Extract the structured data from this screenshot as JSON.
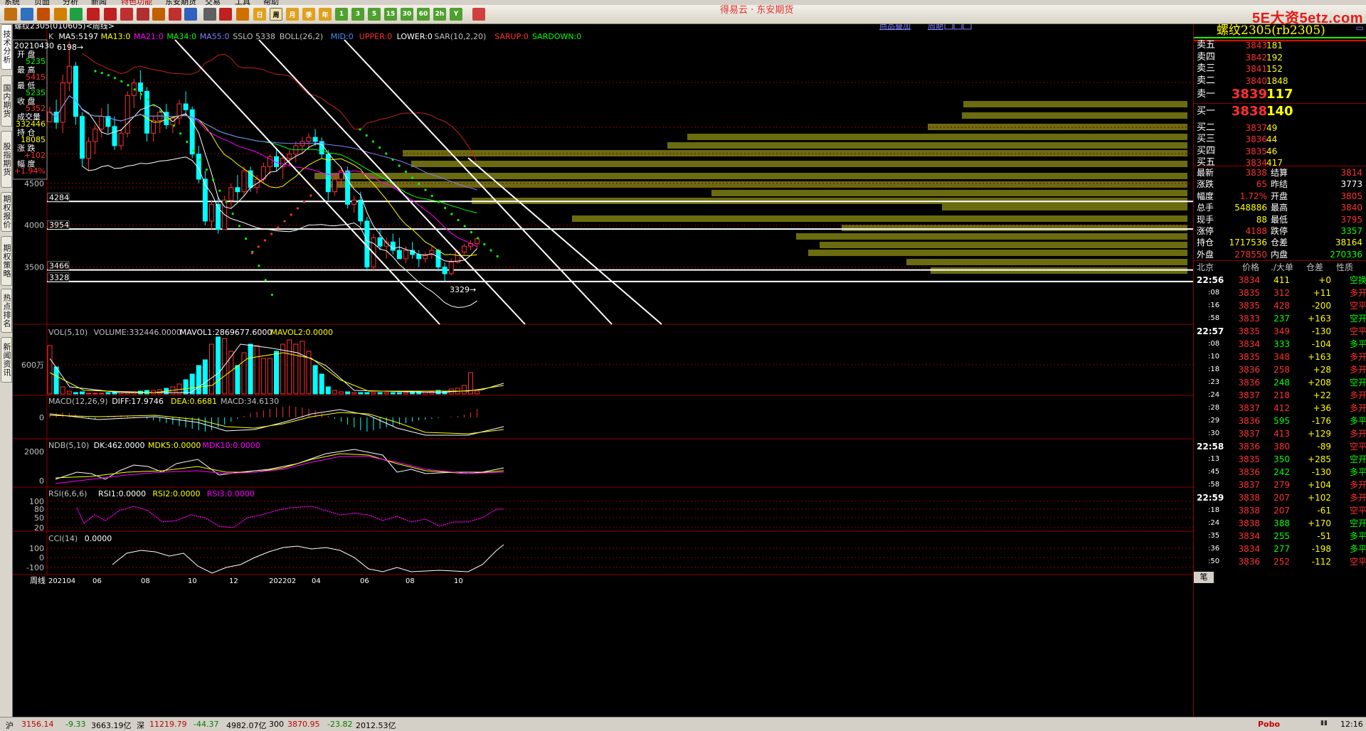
{
  "menu": [
    "系统",
    "页面",
    "分析",
    "新闻",
    "特色功能",
    "东安期货",
    "交易",
    "工具",
    "帮助"
  ],
  "banner": "得易云 · 东安期货",
  "watermark": "5E大资5etz.com",
  "toolbar_periods": [
    "日",
    "周",
    "月",
    "季",
    "年",
    "1",
    "3",
    "5",
    "15",
    "30",
    "60",
    "2h",
    "Y"
  ],
  "left_tabs": [
    "技术分析",
    "国内期货",
    "股指期货",
    "期权报价",
    "期权策略",
    "热点排名",
    "新闻资讯"
  ],
  "chart": {
    "title": "螺纹2305(010605)<周线>",
    "links": [
      "商品叠加",
      "周期"
    ],
    "ma_legend": [
      {
        "t": "K",
        "c": "#c0c0c0"
      },
      {
        "t": "MA5:5197",
        "c": "#ffffff"
      },
      {
        "t": "MA13:0",
        "c": "#ffff00"
      },
      {
        "t": "MA21:0",
        "c": "#ff00ff"
      },
      {
        "t": "MA34:0",
        "c": "#00ff00"
      },
      {
        "t": "MA55:0",
        "c": "#8080ff"
      },
      {
        "t": "SSLO 5338",
        "c": "#c0c0c0"
      },
      {
        "t": "BOLL(26,2)",
        "c": "#c0c0c0"
      },
      {
        "t": "MID:0",
        "c": "#4090ff"
      },
      {
        "t": "UPPER:0",
        "c": "#ff3030"
      },
      {
        "t": "LOWER:0",
        "c": "#ffffff"
      },
      {
        "t": "SAR(10,2,20)",
        "c": "#c0c0c0"
      },
      {
        "t": "SARUP:0",
        "c": "#ff3030"
      },
      {
        "t": "SARDOWN:0",
        "c": "#00ff00"
      }
    ],
    "price_ticks": [
      {
        "v": 4500,
        "l": "4500"
      },
      {
        "v": 4000,
        "l": "4000"
      },
      {
        "v": 3500,
        "l": "3500"
      }
    ],
    "hlines": [
      {
        "v": 4284,
        "l": "4284"
      },
      {
        "v": 3954,
        "l": "3954"
      },
      {
        "v": 3466,
        "l": "3466"
      },
      {
        "v": 3328,
        "l": "3328"
      }
    ],
    "peak_label": "6198",
    "low_label": "3329",
    "infobox": {
      "date": "20210430",
      "rows": [
        {
          "k": "开  盘",
          "v": "5235",
          "c": "#00ff00"
        },
        {
          "k": "最  高",
          "v": "5415",
          "c": "#ff3030"
        },
        {
          "k": "最  低",
          "v": "5235",
          "c": "#00ff00"
        },
        {
          "k": "收  盘",
          "v": "5352",
          "c": "#ff3030"
        },
        {
          "k": "成交量",
          "v": "332446",
          "c": "#ffff00"
        },
        {
          "k": "持  仓",
          "v": "18085",
          "c": "#ffff00"
        },
        {
          "k": "涨  跌",
          "v": "+102",
          "c": "#ff3030"
        },
        {
          "k": "幅  度",
          "v": "+1.94%",
          "c": "#ff3030"
        }
      ]
    },
    "vol_legend": [
      {
        "t": "VOL(5,10)",
        "c": "#c0c0c0"
      },
      {
        "t": "VOLUME:332446.0000",
        "c": "#c0c0c0"
      },
      {
        "t": "MAVOL1:2869677.6000",
        "c": "#ffffff"
      },
      {
        "t": "MAVOL2:0.0000",
        "c": "#ffff00"
      }
    ],
    "vol_tick": "600万",
    "macd_legend": [
      {
        "t": "MACD(12,26,9)",
        "c": "#c0c0c0"
      },
      {
        "t": "DIFF:17.9746",
        "c": "#ffffff"
      },
      {
        "t": "DEA:0.6681",
        "c": "#ffff00"
      },
      {
        "t": "MACD:34.6130",
        "c": "#c0c0c0"
      }
    ],
    "macd_tick": "0",
    "ndb_legend": [
      {
        "t": "NDB(5,10)",
        "c": "#c0c0c0"
      },
      {
        "t": "DK:462.0000",
        "c": "#ffffff"
      },
      {
        "t": "MDK5:0.0000",
        "c": "#ffff00"
      },
      {
        "t": "MDK10:0.0000",
        "c": "#ff00ff"
      }
    ],
    "ndb_ticks": [
      "2000",
      "0"
    ],
    "rsi_legend": [
      {
        "t": "RSI(6,6,6)",
        "c": "#c0c0c0"
      },
      {
        "t": "RSI1:0.0000",
        "c": "#ffffff"
      },
      {
        "t": "RSI2:0.0000",
        "c": "#ffff00"
      },
      {
        "t": "RSI3:0.0000",
        "c": "#ff00ff"
      }
    ],
    "rsi_ticks": [
      "100",
      "80",
      "50",
      "20"
    ],
    "cci_legend": [
      {
        "t": "CCI(14)",
        "c": "#c0c0c0"
      },
      {
        "t": "0.0000",
        "c": "#ffffff"
      }
    ],
    "cci_ticks": [
      "100",
      "0",
      "-100"
    ],
    "x_period": "周线",
    "x_labels": [
      "202104",
      "06",
      "08",
      "10",
      "12",
      "202202",
      "04",
      "06",
      "08",
      "10"
    ]
  },
  "quote": {
    "title": "螺纹2305(rb2305)",
    "asks": [
      {
        "k": "卖五",
        "p": "3843",
        "q": "181"
      },
      {
        "k": "卖四",
        "p": "3842",
        "q": "192"
      },
      {
        "k": "卖三",
        "p": "3841",
        "q": "152"
      },
      {
        "k": "卖二",
        "p": "3840",
        "q": "1848"
      },
      {
        "k": "卖一",
        "p": "3839",
        "q": "117"
      }
    ],
    "bids": [
      {
        "k": "买一",
        "p": "3838",
        "q": "140"
      },
      {
        "k": "买二",
        "p": "3837",
        "q": "49"
      },
      {
        "k": "买三",
        "p": "3836",
        "q": "44"
      },
      {
        "k": "买四",
        "p": "3835",
        "q": "46"
      },
      {
        "k": "买五",
        "p": "3834",
        "q": "417"
      }
    ],
    "stats": [
      {
        "k1": "最新",
        "v1": "3838",
        "c1": "#ff3030",
        "k2": "结算",
        "v2": "3814",
        "c2": "#ff3030"
      },
      {
        "k1": "涨跌",
        "v1": "65",
        "c1": "#ff3030",
        "k2": "昨结",
        "v2": "3773",
        "c2": "#ffffff"
      },
      {
        "k1": "幅度",
        "v1": "1.72%",
        "c1": "#ff3030",
        "k2": "开盘",
        "v2": "3805",
        "c2": "#ff3030"
      },
      {
        "k1": "总手",
        "v1": "548886",
        "c1": "#ffff00",
        "k2": "最高",
        "v2": "3840",
        "c2": "#ff3030"
      },
      {
        "k1": "现手",
        "v1": "88",
        "c1": "#ffff00",
        "k2": "最低",
        "v2": "3795",
        "c2": "#ff3030"
      },
      {
        "k1": "涨停",
        "v1": "4188",
        "c1": "#ff3030",
        "k2": "跌停",
        "v2": "3357",
        "c2": "#00ff00"
      },
      {
        "k1": "持仓",
        "v1": "1717536",
        "c1": "#ffff00",
        "k2": "仓差",
        "v2": "38164",
        "c2": "#ffff00"
      },
      {
        "k1": "外盘",
        "v1": "278550",
        "c1": "#ff3030",
        "k2": "内盘",
        "v2": "270336",
        "c2": "#00ff00"
      }
    ],
    "trade_headers": [
      "北京",
      "价格",
      "./大单",
      "仓差",
      "性质"
    ],
    "trades": [
      {
        "t": "22:56",
        "big": true,
        "p": "3834",
        "v": "411",
        "d": "+0",
        "n": "空换",
        "pc": "#ff3030",
        "vc": "#ffff00",
        "dc": "#ffff00",
        "nc": "#00ff00"
      },
      {
        "t": ":08",
        "p": "3835",
        "v": "312",
        "d": "+11",
        "n": "多开",
        "pc": "#ff3030",
        "vc": "#ff3030",
        "dc": "#ffff00",
        "nc": "#ff3030"
      },
      {
        "t": ":16",
        "p": "3835",
        "v": "428",
        "d": "-200",
        "n": "空平",
        "pc": "#ff3030",
        "vc": "#ff3030",
        "dc": "#ffff00",
        "nc": "#ff3030"
      },
      {
        "t": ":58",
        "p": "3833",
        "v": "237",
        "d": "+163",
        "n": "空开",
        "pc": "#ff3030",
        "vc": "#00ff00",
        "dc": "#ffff00",
        "nc": "#00ff00"
      },
      {
        "t": "22:57",
        "big": true,
        "p": "3835",
        "v": "349",
        "d": "-130",
        "n": "空平",
        "pc": "#ff3030",
        "vc": "#ff3030",
        "dc": "#ffff00",
        "nc": "#ff3030"
      },
      {
        "t": ":08",
        "p": "3834",
        "v": "333",
        "d": "-104",
        "n": "多平",
        "pc": "#ff3030",
        "vc": "#00ff00",
        "dc": "#ffff00",
        "nc": "#00ff00"
      },
      {
        "t": ":10",
        "p": "3835",
        "v": "348",
        "d": "+163",
        "n": "多开",
        "pc": "#ff3030",
        "vc": "#ff3030",
        "dc": "#ffff00",
        "nc": "#ff3030"
      },
      {
        "t": ":18",
        "p": "3836",
        "v": "258",
        "d": "+28",
        "n": "多开",
        "pc": "#ff3030",
        "vc": "#ff3030",
        "dc": "#ffff00",
        "nc": "#ff3030"
      },
      {
        "t": ":23",
        "p": "3836",
        "v": "248",
        "d": "+208",
        "n": "空开",
        "pc": "#ff3030",
        "vc": "#00ff00",
        "dc": "#ffff00",
        "nc": "#00ff00"
      },
      {
        "t": ":24",
        "p": "3837",
        "v": "218",
        "d": "+22",
        "n": "多开",
        "pc": "#ff3030",
        "vc": "#ff3030",
        "dc": "#ffff00",
        "nc": "#ff3030"
      },
      {
        "t": ":28",
        "p": "3837",
        "v": "412",
        "d": "+36",
        "n": "多开",
        "pc": "#ff3030",
        "vc": "#ff3030",
        "dc": "#ffff00",
        "nc": "#ff3030"
      },
      {
        "t": ":29",
        "p": "3836",
        "v": "595",
        "d": "-176",
        "n": "多平",
        "pc": "#ff3030",
        "vc": "#00ff00",
        "dc": "#ffff00",
        "nc": "#00ff00"
      },
      {
        "t": ":30",
        "p": "3837",
        "v": "413",
        "d": "+129",
        "n": "多开",
        "pc": "#ff3030",
        "vc": "#ff3030",
        "dc": "#ffff00",
        "nc": "#ff3030"
      },
      {
        "t": "22:58",
        "big": true,
        "p": "3836",
        "v": "380",
        "d": "-89",
        "n": "空平",
        "pc": "#ff3030",
        "vc": "#ff3030",
        "dc": "#ffff00",
        "nc": "#ff3030"
      },
      {
        "t": ":13",
        "p": "3835",
        "v": "350",
        "d": "+285",
        "n": "空开",
        "pc": "#ff3030",
        "vc": "#00ff00",
        "dc": "#ffff00",
        "nc": "#00ff00"
      },
      {
        "t": ":45",
        "p": "3836",
        "v": "242",
        "d": "-130",
        "n": "多平",
        "pc": "#ff3030",
        "vc": "#00ff00",
        "dc": "#ffff00",
        "nc": "#00ff00"
      },
      {
        "t": ":58",
        "p": "3837",
        "v": "279",
        "d": "+104",
        "n": "多开",
        "pc": "#ff3030",
        "vc": "#ff3030",
        "dc": "#ffff00",
        "nc": "#ff3030"
      },
      {
        "t": "22:59",
        "big": true,
        "p": "3838",
        "v": "207",
        "d": "+102",
        "n": "多开",
        "pc": "#ff3030",
        "vc": "#ff3030",
        "dc": "#ffff00",
        "nc": "#ff3030"
      },
      {
        "t": ":18",
        "p": "3838",
        "v": "207",
        "d": "-61",
        "n": "空平",
        "pc": "#ff3030",
        "vc": "#ff3030",
        "dc": "#ffff00",
        "nc": "#ff3030"
      },
      {
        "t": ":24",
        "p": "3838",
        "v": "388",
        "d": "+170",
        "n": "空开",
        "pc": "#ff3030",
        "vc": "#00ff00",
        "dc": "#ffff00",
        "nc": "#00ff00"
      },
      {
        "t": ":35",
        "p": "3834",
        "v": "255",
        "d": "-51",
        "n": "多平",
        "pc": "#ff3030",
        "vc": "#00ff00",
        "dc": "#ffff00",
        "nc": "#00ff00"
      },
      {
        "t": ":36",
        "p": "3834",
        "v": "277",
        "d": "-198",
        "n": "多平",
        "pc": "#ff3030",
        "vc": "#00ff00",
        "dc": "#ffff00",
        "nc": "#00ff00"
      },
      {
        "t": ":50",
        "p": "3836",
        "v": "252",
        "d": "-112",
        "n": "空平",
        "pc": "#ff3030",
        "vc": "#ff3030",
        "dc": "#ffff00",
        "nc": "#ff3030"
      }
    ],
    "footer_tab": "笔"
  },
  "status": {
    "items": [
      {
        "t": "沪",
        "c": "#000"
      },
      {
        "t": "3156.14",
        "c": "#c00000"
      },
      {
        "t": "-9.33",
        "c": "#008000"
      },
      {
        "t": "3663.19亿",
        "c": "#000"
      },
      {
        "t": "深",
        "c": "#000"
      },
      {
        "t": "11219.79",
        "c": "#c00000"
      },
      {
        "t": "-44.37",
        "c": "#008000"
      },
      {
        "t": "4982.07亿",
        "c": "#000"
      },
      {
        "t": "300",
        "c": "#000"
      },
      {
        "t": "3870.95",
        "c": "#c00000"
      },
      {
        "t": "-23.82",
        "c": "#008000"
      },
      {
        "t": "2012.53亿",
        "c": "#000"
      }
    ],
    "brand": "Pobo",
    "time": "12:16"
  }
}
